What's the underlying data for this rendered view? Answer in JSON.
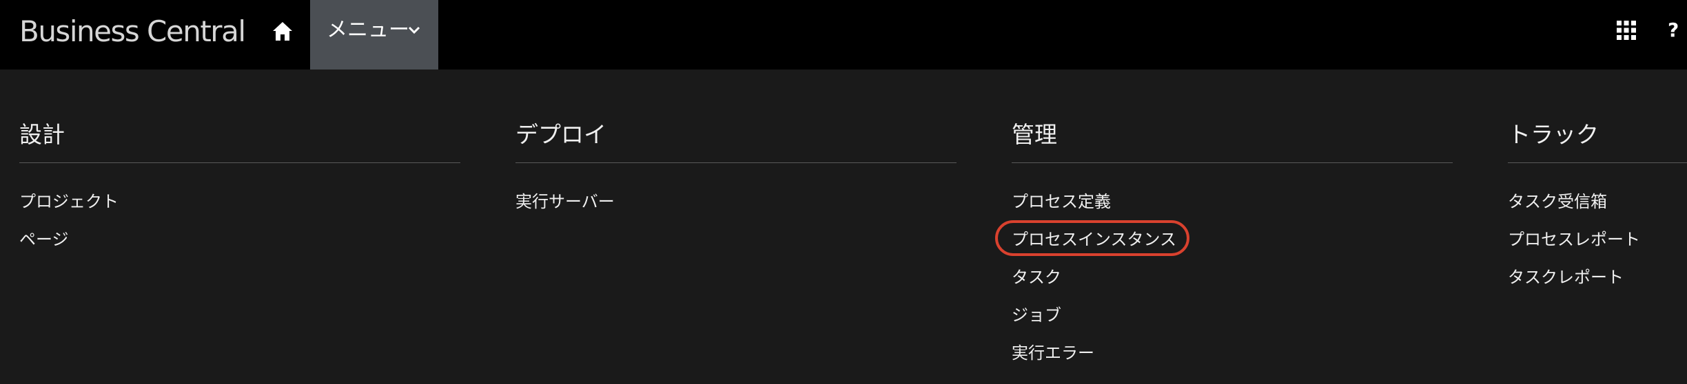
{
  "header": {
    "brand": "Business Central",
    "menu_label": "メニュー",
    "help_label": "?"
  },
  "columns": [
    {
      "title": "設計",
      "items": [
        "プロジェクト",
        "ページ"
      ]
    },
    {
      "title": "デプロイ",
      "items": [
        "実行サーバー"
      ]
    },
    {
      "title": "管理",
      "items": [
        "プロセス定義",
        "プロセスインスタンス",
        "タスク",
        "ジョブ",
        "実行エラー"
      ]
    },
    {
      "title": "トラック",
      "items": [
        "タスク受信箱",
        "プロセスレポート",
        "タスクレポート"
      ]
    }
  ],
  "colors": {
    "topbar": "#000000",
    "background": "#1a1a1a",
    "menu_active": "#4b4f54",
    "highlight": "#d9412e"
  }
}
